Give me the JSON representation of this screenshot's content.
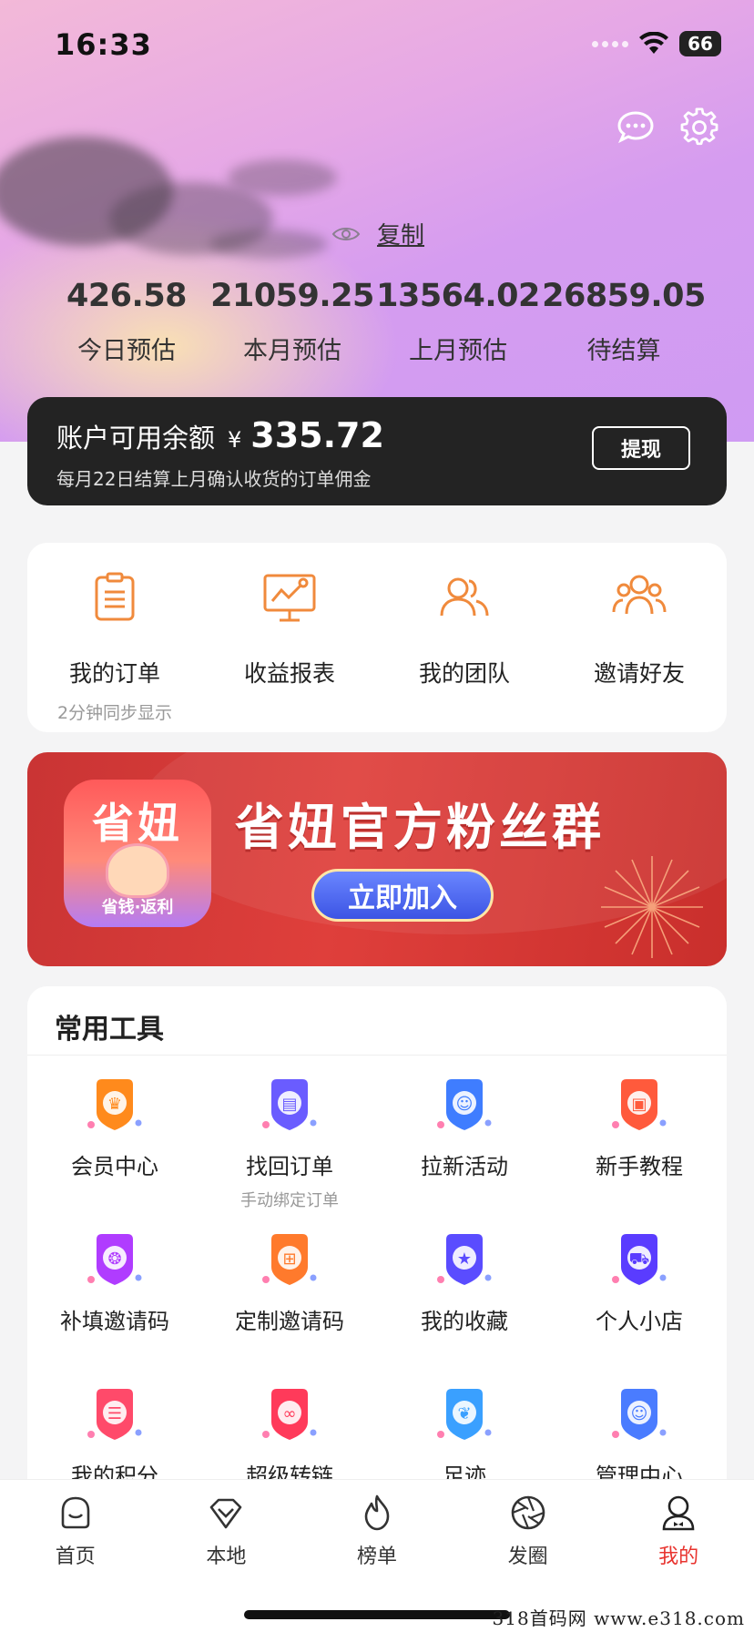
{
  "status_bar": {
    "time": "16:33",
    "battery": "66"
  },
  "profile": {
    "copy_label": "复制"
  },
  "stats": [
    {
      "value": "426.58",
      "label": "今日预估"
    },
    {
      "value": "21059.25",
      "label": "本月预估"
    },
    {
      "value": "13564.02",
      "label": "上月预估"
    },
    {
      "value": "26859.05",
      "label": "待结算"
    }
  ],
  "balance": {
    "title": "账户可用余额",
    "currency": "¥",
    "amount": "335.72",
    "note": "每月22日结算上月确认收货的订单佣金",
    "withdraw_label": "提现"
  },
  "quick": [
    {
      "label": "我的订单",
      "sub": "2分钟同步显示",
      "icon": "order-icon"
    },
    {
      "label": "收益报表",
      "sub": "",
      "icon": "report-icon"
    },
    {
      "label": "我的团队",
      "sub": "",
      "icon": "team-icon"
    },
    {
      "label": "邀请好友",
      "sub": "",
      "icon": "invite-icon"
    }
  ],
  "banner": {
    "logo_title": "省妞",
    "logo_sub": "省钱·返利",
    "title": "省妞官方粉丝群",
    "button": "立即加入"
  },
  "tools": {
    "title": "常用工具",
    "items": [
      {
        "label": "会员中心",
        "sub": "",
        "icon": "crown-icon",
        "color": "#ff8a1c"
      },
      {
        "label": "找回订单",
        "sub": "手动绑定订单",
        "icon": "clipboard-icon",
        "color": "#6a5cff"
      },
      {
        "label": "拉新活动",
        "sub": "",
        "icon": "user-card-icon",
        "color": "#3f7dff"
      },
      {
        "label": "新手教程",
        "sub": "",
        "icon": "tutorial-icon",
        "color": "#ff5a3c"
      },
      {
        "label": "补填邀请码",
        "sub": "",
        "icon": "aperture-icon",
        "color": "#b03cff"
      },
      {
        "label": "定制邀请码",
        "sub": "",
        "icon": "grid-icon",
        "color": "#ff7a2c"
      },
      {
        "label": "我的收藏",
        "sub": "",
        "icon": "star-icon",
        "color": "#5a4cff"
      },
      {
        "label": "个人小店",
        "sub": "",
        "icon": "cart-icon",
        "color": "#5a3cff"
      },
      {
        "label": "我的积分",
        "sub": "",
        "icon": "coins-icon",
        "color": "#ff4a6a"
      },
      {
        "label": "超级转链",
        "sub": "",
        "icon": "link-icon",
        "color": "#ff3a5a"
      },
      {
        "label": "足迹",
        "sub": "",
        "icon": "footprint-icon",
        "color": "#3aa0ff"
      },
      {
        "label": "管理中心",
        "sub": "",
        "icon": "manage-icon",
        "color": "#4a7cff"
      }
    ]
  },
  "tabbar": [
    {
      "label": "首页",
      "icon": "home-icon",
      "active": false
    },
    {
      "label": "本地",
      "icon": "local-icon",
      "active": false
    },
    {
      "label": "榜单",
      "icon": "flame-icon",
      "active": false
    },
    {
      "label": "发圈",
      "icon": "aperture-icon",
      "active": false
    },
    {
      "label": "我的",
      "icon": "profile-icon",
      "active": true
    }
  ],
  "accent_color": "#e8332e",
  "watermark": "318首码网 www.e318.com"
}
